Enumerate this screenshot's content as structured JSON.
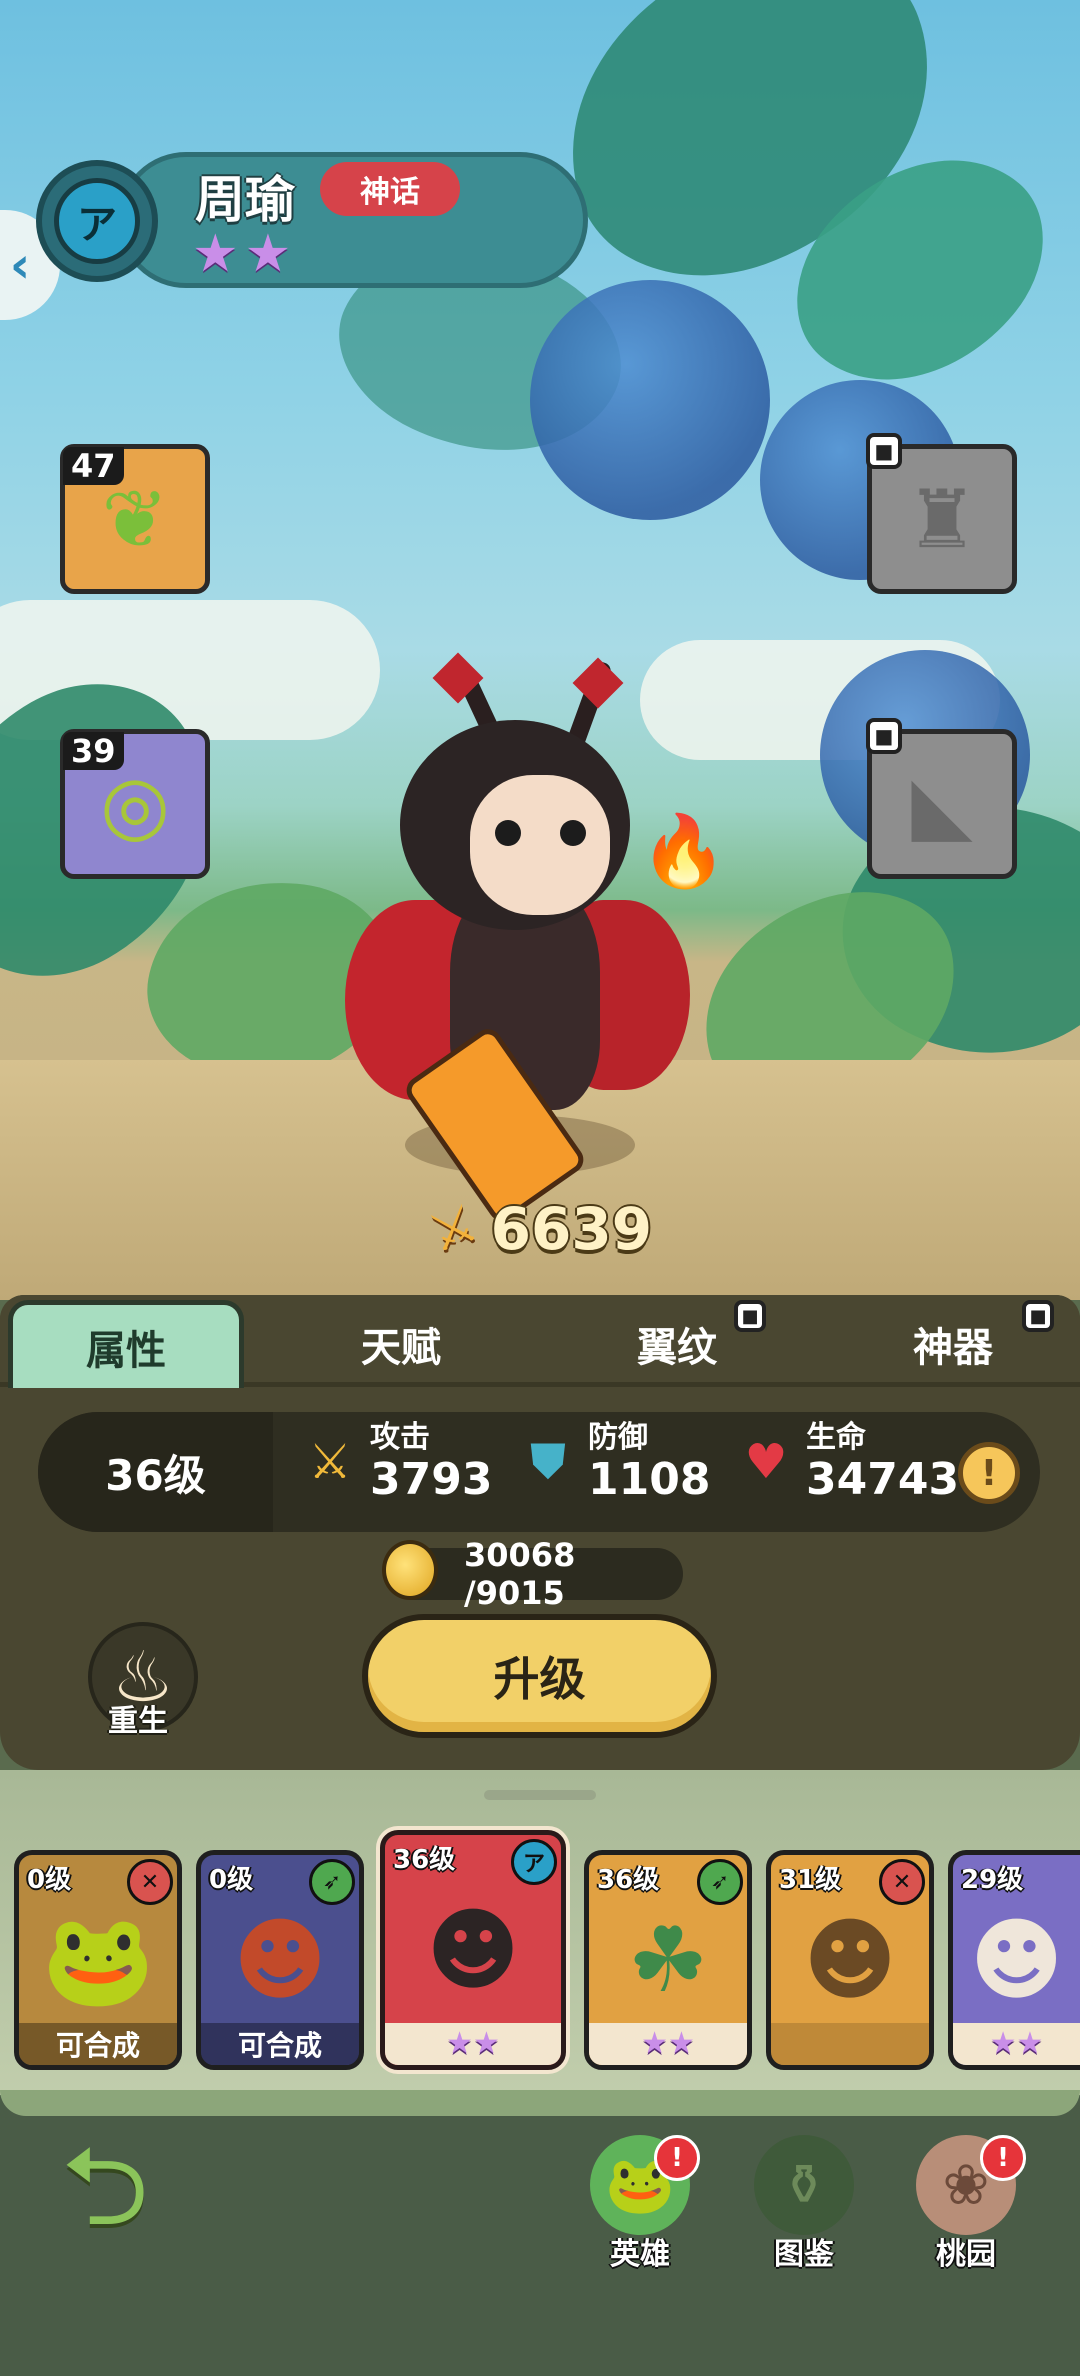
{
  "hero": {
    "name": "周瑜",
    "rarity": "神话",
    "stars": "★★",
    "power": "6639"
  },
  "equipment": [
    {
      "level": "47",
      "icon": "leaf-scepter-icon",
      "state": "equipped"
    },
    {
      "level": "39",
      "icon": "ring-icon",
      "state": "equipped"
    },
    {
      "icon": "armor-icon",
      "state": "locked"
    },
    {
      "icon": "boot-icon",
      "state": "locked"
    }
  ],
  "tabs": [
    {
      "label": "属性",
      "active": true,
      "locked": false
    },
    {
      "label": "天赋",
      "active": false,
      "locked": false
    },
    {
      "label": "翼纹",
      "active": false,
      "locked": true
    },
    {
      "label": "神器",
      "active": false,
      "locked": true
    }
  ],
  "stats": {
    "level": "36级",
    "attack": {
      "label": "攻击",
      "value": "3793"
    },
    "defense": {
      "label": "防御",
      "value": "1108"
    },
    "hp": {
      "label": "生命",
      "value": "34743"
    }
  },
  "upgrade_cost": "30068 /9015",
  "buttons": {
    "rebirth": "重生",
    "upgrade": "升级"
  },
  "roster": [
    {
      "level": "0级",
      "footer": "可合成",
      "class_icon": "crossed-blades-icon",
      "class_color": "#d9534f",
      "bg": "#b7893e"
    },
    {
      "level": "0级",
      "footer": "可合成",
      "class_icon": "bow-icon",
      "class_color": "#4fa84f",
      "bg": "#4b4f8e"
    },
    {
      "level": "36级",
      "footer": "★★",
      "class_icon": "staff-icon",
      "class_color": "#2aa0c8",
      "bg": "#d6434a"
    },
    {
      "level": "36级",
      "footer": "★★",
      "class_icon": "bow-icon",
      "class_color": "#4fa84f",
      "bg": "#e1a142"
    },
    {
      "level": "31级",
      "footer": "",
      "class_icon": "crossed-blades-icon",
      "class_color": "#d9534f",
      "bg": "#e1a142"
    },
    {
      "level": "29级",
      "footer": "★★",
      "class_icon": "crossed-blades-icon",
      "class_color": "#d9534f",
      "bg": "#7a6ec4"
    }
  ],
  "nav": [
    {
      "label": "英雄",
      "icon": "frog-hero-icon",
      "badge": "!"
    },
    {
      "label": "图鉴",
      "icon": "puzzle-jar-icon",
      "badge": ""
    },
    {
      "label": "桃园",
      "icon": "peach-garden-icon",
      "badge": "!"
    }
  ],
  "colors": {
    "rarity_red": "#d6434a",
    "star_purple": "#c98ee8",
    "upgrade_yellow": "#f2d068",
    "active_tab": "#a7ddc0",
    "panel_dark": "#4a4731"
  }
}
